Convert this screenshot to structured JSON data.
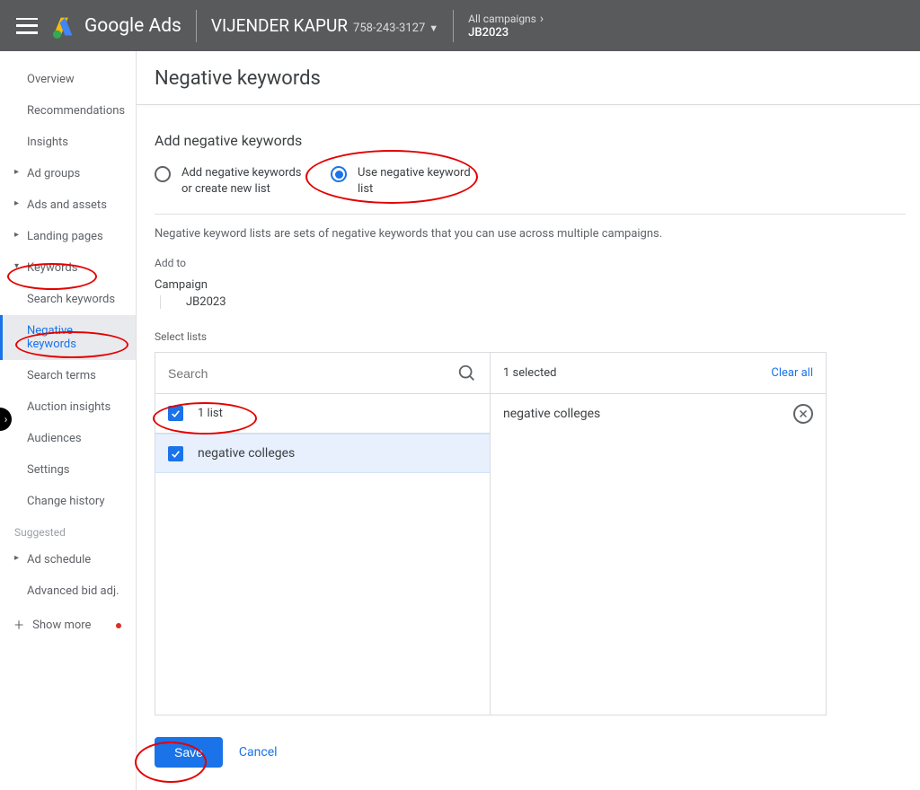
{
  "header": {
    "product": "Google Ads",
    "account_name": "VIJENDER KAPUR",
    "account_id": "758-243-3127",
    "crumb_top": "All campaigns",
    "crumb_bottom": "JB2023"
  },
  "sidenav": {
    "overview": "Overview",
    "recommendations": "Recommendations",
    "insights": "Insights",
    "ad_groups": "Ad groups",
    "ads_assets": "Ads and assets",
    "landing_pages": "Landing pages",
    "keywords": "Keywords",
    "search_keywords": "Search keywords",
    "negative_keywords": "Negative keywords",
    "search_terms": "Search terms",
    "auction_insights": "Auction insights",
    "audiences": "Audiences",
    "settings": "Settings",
    "change_history": "Change history",
    "suggested_label": "Suggested",
    "ad_schedule": "Ad schedule",
    "advanced_bid": "Advanced bid adj.",
    "show_more": "Show more"
  },
  "page": {
    "title": "Negative keywords",
    "section_title": "Add negative keywords",
    "radio_add": "Add negative keywords or create new list",
    "radio_use": "Use negative keyword list",
    "desc": "Negative keyword lists are sets of negative keywords that you can use across multiple campaigns.",
    "add_to_label": "Add to",
    "campaign_label": "Campaign",
    "campaign_value": "JB2023",
    "select_lists_label": "Select lists",
    "search_placeholder": "Search",
    "list_count": "1 list",
    "list_items": [
      "negative colleges"
    ],
    "selected_count": "1 selected",
    "clear_all": "Clear all",
    "selected_items": [
      "negative colleges"
    ],
    "save": "Save",
    "cancel": "Cancel"
  }
}
